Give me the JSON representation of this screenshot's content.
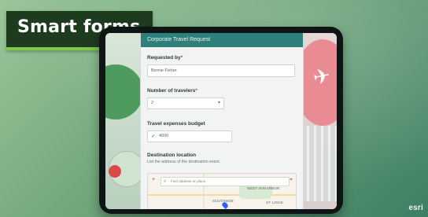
{
  "overlay": {
    "title": "Smart forms"
  },
  "form": {
    "header_title": "Corporate Travel Request",
    "requested_by": {
      "label": "Requested by",
      "required_mark": "*",
      "value": "Bernie Fisher"
    },
    "travelers": {
      "label": "Number of travelers",
      "required_mark": "*",
      "value": "2"
    },
    "budget": {
      "label": "Travel expenses budget",
      "value": "4000"
    },
    "destination": {
      "label": "Destination location",
      "hint": "List the address of the destination event."
    }
  },
  "map": {
    "search_placeholder": "Find address or place",
    "place_labels": [
      "SOUTHSIDE",
      "WEST ANN ARBOR",
      "ST. LOUIS"
    ]
  },
  "branding": {
    "logo_text": "esri"
  },
  "colors": {
    "banner": "#1f3b1f",
    "banner_accent": "#7fc64a",
    "form_header": "#2f7f7a"
  }
}
